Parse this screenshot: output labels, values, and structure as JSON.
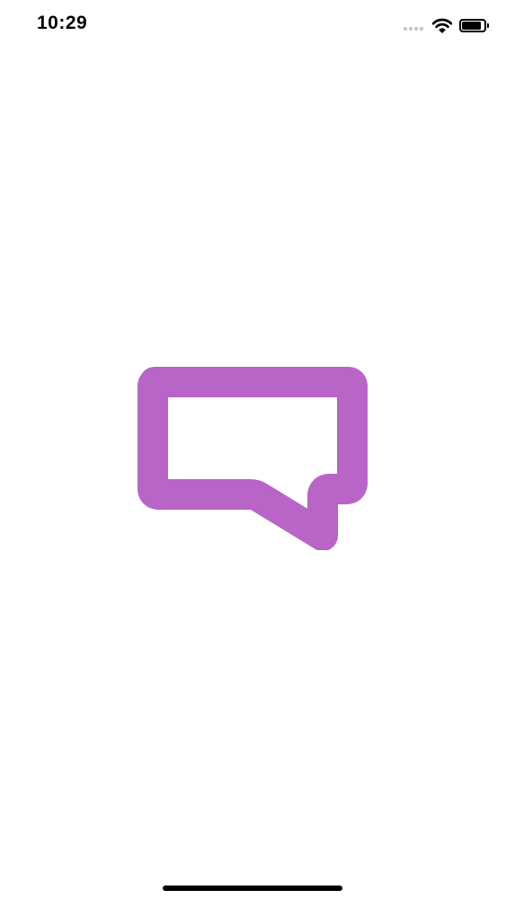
{
  "status_bar": {
    "time": "10:29",
    "signal_icon": "cellular-signal-icon",
    "wifi_icon": "wifi-icon",
    "battery_icon": "battery-icon",
    "battery_level": 0.95
  },
  "splash": {
    "logo_icon": "chat-bubble-icon",
    "logo_color": "#B964C7"
  },
  "home_indicator": {
    "color": "#000000"
  }
}
